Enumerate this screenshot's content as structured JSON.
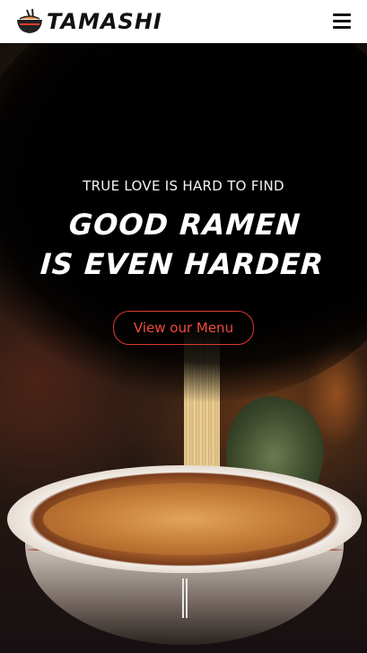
{
  "header": {
    "brand": "TAMASHI",
    "logo_icon": "ramen-bowl-icon",
    "menu_icon": "hamburger-menu-icon"
  },
  "hero": {
    "tagline": "TRUE LOVE IS HARD TO FIND",
    "headline_line1": "GOOD RAMEN",
    "headline_line2": "IS EVEN HARDER",
    "cta_label": "View our Menu",
    "scroll_icon": "scroll-indicator-icon"
  },
  "colors": {
    "accent": "#e03a2e",
    "header_bg": "#ffffff",
    "text_light": "#ffffff"
  }
}
